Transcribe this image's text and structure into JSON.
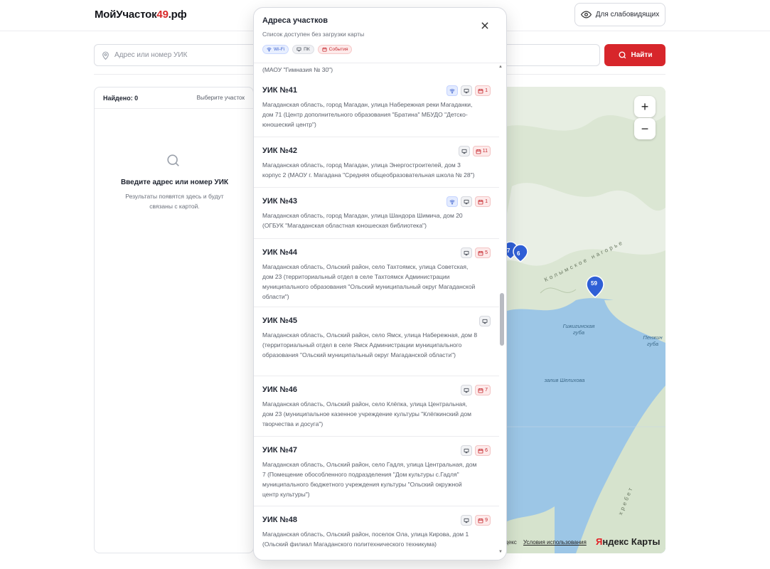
{
  "header": {
    "logo_main": "МойУчасток",
    "logo_accent": "49",
    "logo_suffix": ".рф",
    "a11y_label": "Для слабовидящих"
  },
  "search": {
    "placeholder": "Адрес или номер УИК",
    "button_label": "Найти"
  },
  "results": {
    "found_label": "Найдено: 0",
    "choose_label": "Выберите участок",
    "empty_title": "Введите адрес или номер УИК",
    "empty_subtitle": "Результаты появятся здесь и будут связаны с картой."
  },
  "map": {
    "zoom_in": "+",
    "zoom_out": "−",
    "pin_label": "59",
    "pin_partial_a": "7",
    "pin_partial_b": "6",
    "label_gizhiga": "Гижигинская губа",
    "label_shelikhov": "залив Шелихова",
    "label_penzhin": "Пенжин губа",
    "label_ridge": "Колымское нагорье",
    "label_ridge2": "хребет",
    "footer_prefix": "декс",
    "footer_terms": "Условия использования",
    "brand_y": "Я",
    "brand_rest": "ндекс Карты",
    "colors": {
      "water": "#9cc6e6",
      "land": "#dfe9d9",
      "pin": "#2f5fd6"
    }
  },
  "modal": {
    "title": "Адреса участков",
    "subtitle": "Список доступен без загрузки карты",
    "chips": {
      "wifi": "Wi-Fi",
      "pc": "ПК",
      "event": "События"
    },
    "partial_top": "(МАОУ \"Гимназия № 30\")",
    "items": [
      {
        "title": "УИК №41",
        "address": "Магаданская область, город Магадан, улица Набережная реки Магаданки, дом 71 (Центр дополнительного образования \"Братина\" МБУДО \"Детско-юношеский центр\")",
        "wifi": true,
        "pc": true,
        "events": "1"
      },
      {
        "title": "УИК №42",
        "address": "Магаданская область, город Магадан, улица Энергостроителей, дом 3 корпус 2 (МАОУ г. Магадана \"Средняя общеобразовательная школа № 28\")",
        "wifi": false,
        "pc": true,
        "events": "11"
      },
      {
        "title": "УИК №43",
        "address": "Магаданская область, город Магадан, улица Шандора Шимича, дом 20 (ОГБУК \"Магаданская областная юношеская библиотека\")",
        "wifi": true,
        "pc": true,
        "events": "1"
      },
      {
        "title": "УИК №44",
        "address": "Магаданская область, Ольский район, село Тахтоямск, улица Советская, дом 23 (территориальный отдел в селе Тахтоямск Администрации муниципального образования \"Ольский муниципальный округ Магаданской области\")",
        "wifi": false,
        "pc": true,
        "events": "5"
      },
      {
        "title": "УИК №45",
        "address": "Магаданская область, Ольский район, село Ямск, улица Набережная, дом 8 (территориальный отдел в селе Ямск Администрации муниципального образования \"Ольский муниципальный округ Магаданской области\")",
        "wifi": false,
        "pc": true,
        "events": ""
      },
      {
        "title": "УИК №46",
        "address": "Магаданская область, Ольский район, село Клёпка, улица Центральная, дом 23 (муниципальное казенное учреждение культуры \"Клёпкинский дом творчества и досуга\")",
        "wifi": false,
        "pc": true,
        "events": "7"
      },
      {
        "title": "УИК №47",
        "address": "Магаданская область, Ольский район, село Гадля, улица Центральная, дом 7 (Помещение обособленного подразделения \"Дом культуры с.Гадля\" муниципального бюджетного учреждения культуры \"Ольский окружной центр культуры\")",
        "wifi": false,
        "pc": true,
        "events": "6"
      },
      {
        "title": "УИК №48",
        "address": "Магаданская область, Ольский район, поселок Ола, улица Кирова, дом 1 (Ольский филиал Магаданского политехнического техникума)",
        "wifi": false,
        "pc": true,
        "events": "9"
      }
    ]
  }
}
